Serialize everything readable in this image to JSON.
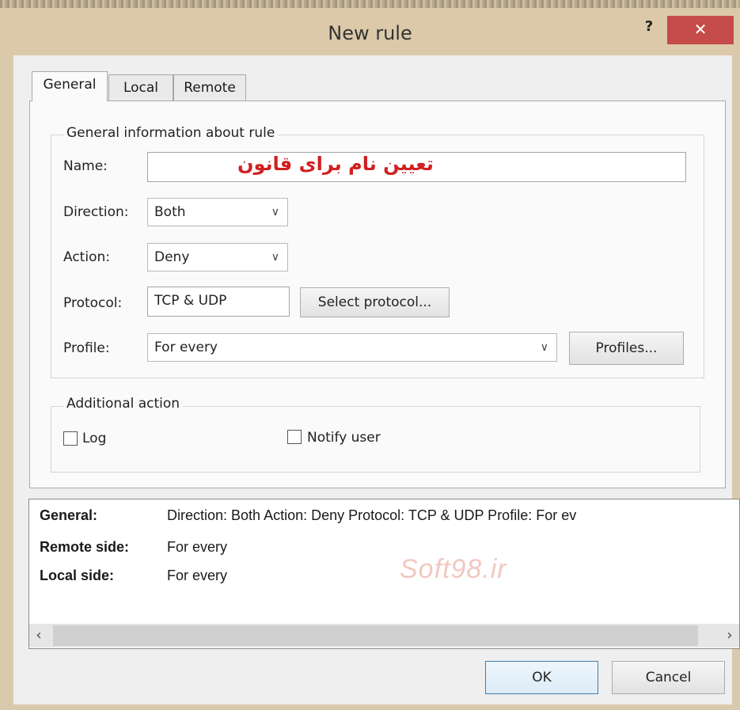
{
  "window": {
    "title": "New rule",
    "help_label": "?",
    "close_label": "✕"
  },
  "tabs": [
    {
      "label": "General",
      "active": true
    },
    {
      "label": "Local",
      "active": false
    },
    {
      "label": "Remote",
      "active": false
    }
  ],
  "general_info": {
    "group_title": "General information about rule",
    "name_label": "Name:",
    "name_value": "",
    "name_hint": "تعیین نام برای قانون",
    "direction_label": "Direction:",
    "direction_value": "Both",
    "action_label": "Action:",
    "action_value": "Deny",
    "protocol_label": "Protocol:",
    "protocol_value": "TCP & UDP",
    "select_protocol_label": "Select protocol...",
    "profile_label": "Profile:",
    "profile_value": "For every",
    "profiles_button_label": "Profiles..."
  },
  "additional_action": {
    "group_title": "Additional action",
    "log_label": "Log",
    "log_checked": false,
    "notify_label": "Notify user",
    "notify_checked": false
  },
  "summary": {
    "general_key": "General:",
    "general_value": "Direction: Both   Action: Deny   Protocol: TCP & UDP   Profile: For ev",
    "remote_key": "Remote side:",
    "remote_value": "For every",
    "local_key": "Local side:",
    "local_value": "For every",
    "watermark": "Soft98.ir"
  },
  "buttons": {
    "ok": "OK",
    "cancel": "Cancel"
  },
  "icons": {
    "dropdown": "chevron-down-icon",
    "scroll_left": "arrow-left-icon",
    "scroll_right": "arrow-right-icon"
  }
}
